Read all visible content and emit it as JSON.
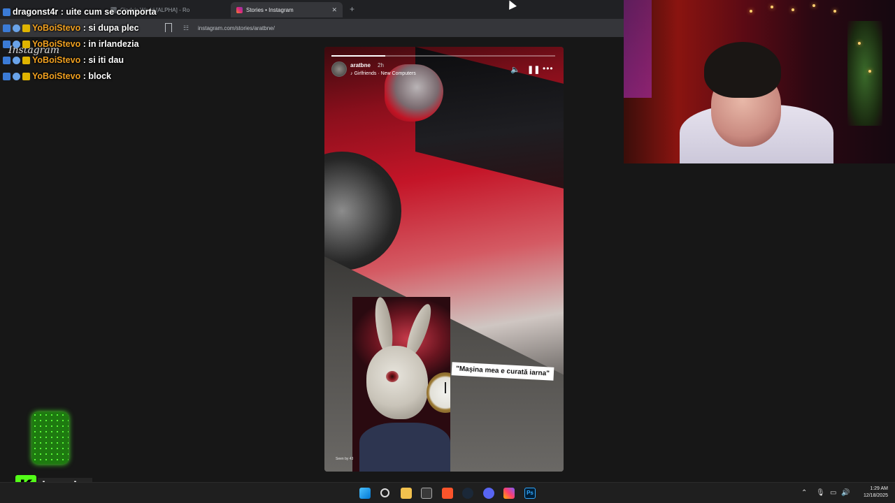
{
  "browser": {
    "tabs": [
      {
        "label": "Cindy's World [ALPHA] - Ro",
        "active": false
      },
      {
        "label": "Stories • Instagram",
        "active": true
      }
    ],
    "new_tab_icon": "plus-icon",
    "url": "instagram.com/stories/aratbne/"
  },
  "instagram": {
    "logo_text": "Instagram"
  },
  "story": {
    "progress_fraction": 0.24,
    "username": "aratbne",
    "time_ago": "2h",
    "music": "Girlfriends · New Computers",
    "caption": "\"Mașina mea e curată iarna\"",
    "seen_by": "Seen by 43"
  },
  "chat": [
    {
      "user": "dragonst4r",
      "message": "uite cum se comporta"
    },
    {
      "user": "YoBoiStevo",
      "message": "si dupa plec"
    },
    {
      "user": "YoBoiStevo",
      "message": "in irlandezia"
    },
    {
      "user": "YoBoiStevo",
      "message": "si iti dau"
    },
    {
      "user": "YoBoiStevo",
      "message": "block"
    }
  ],
  "stream": {
    "channel_name": "lavashy",
    "platform_logo": "K"
  },
  "taskbar": {
    "time": "1:29 AM",
    "date": "12/18/2025",
    "icons": [
      "windows-start-icon",
      "search-icon",
      "file-explorer-icon",
      "store-icon",
      "brave-browser-icon",
      "steam-icon",
      "discord-icon",
      "photos-icon",
      "photoshop-icon"
    ]
  },
  "colors": {
    "chat_username": "#f0a020",
    "kick_green": "#53fc18",
    "story_caption_bg": "#ffffff"
  }
}
